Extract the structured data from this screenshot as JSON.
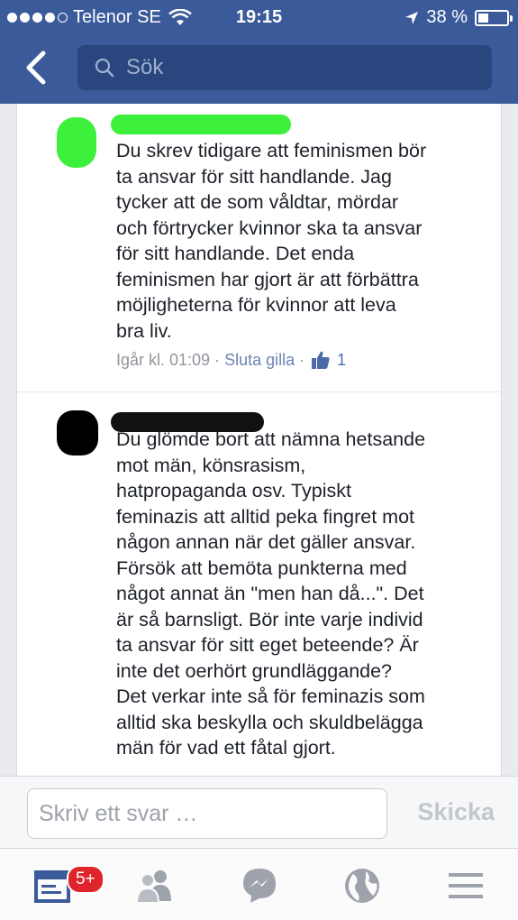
{
  "status": {
    "carrier": "Telenor SE",
    "time": "19:15",
    "battery": "38 %",
    "battery_level": 0.38
  },
  "search": {
    "placeholder": "Sök"
  },
  "comments": [
    {
      "text": "Du skrev tidigare att feminismen bör\nta ansvar för sitt handlande. Jag\ntycker att de som våldtar, mördar\noch förtrycker kvinnor ska ta ansvar\nför sitt handlande. Det enda\nfeminismen har gjort är att förbättra\nmöjligheterna för kvinnor att leva\nbra liv.",
      "timestamp": "Igår kl. 01:09",
      "separator": "·",
      "action": "Sluta gilla",
      "like_count": "1"
    },
    {
      "text": "Du glömde bort att nämna hetsande\nmot män, könsrasism,\nhatpropaganda osv. Typiskt\nfeminazis att alltid peka fingret mot\nnågon annan när det gäller ansvar.\nFörsök att bemöta punkterna med\nnågot annat än \"men han då...\". Det\när så barnsligt. Bör inte varje individ\nta ansvar för sitt eget beteende?  Är\ninte det oerhört grundläggande?\nDet verkar inte så för feminazis som\nalltid ska beskylla och skuldbelägga\nmän för vad ett fåtal gjort."
    }
  ],
  "reply": {
    "placeholder": "Skriv ett svar …",
    "send_label": "Skicka"
  },
  "tabbar": {
    "badge": "5+",
    "icons": [
      "news-feed-icon",
      "friends-icon",
      "messenger-icon",
      "globe-icon",
      "menu-icon"
    ]
  },
  "colors": {
    "header": "#3b5a9a",
    "search_bg": "#2a467f",
    "badge": "#e0242b",
    "like": "#4b6aa8"
  }
}
